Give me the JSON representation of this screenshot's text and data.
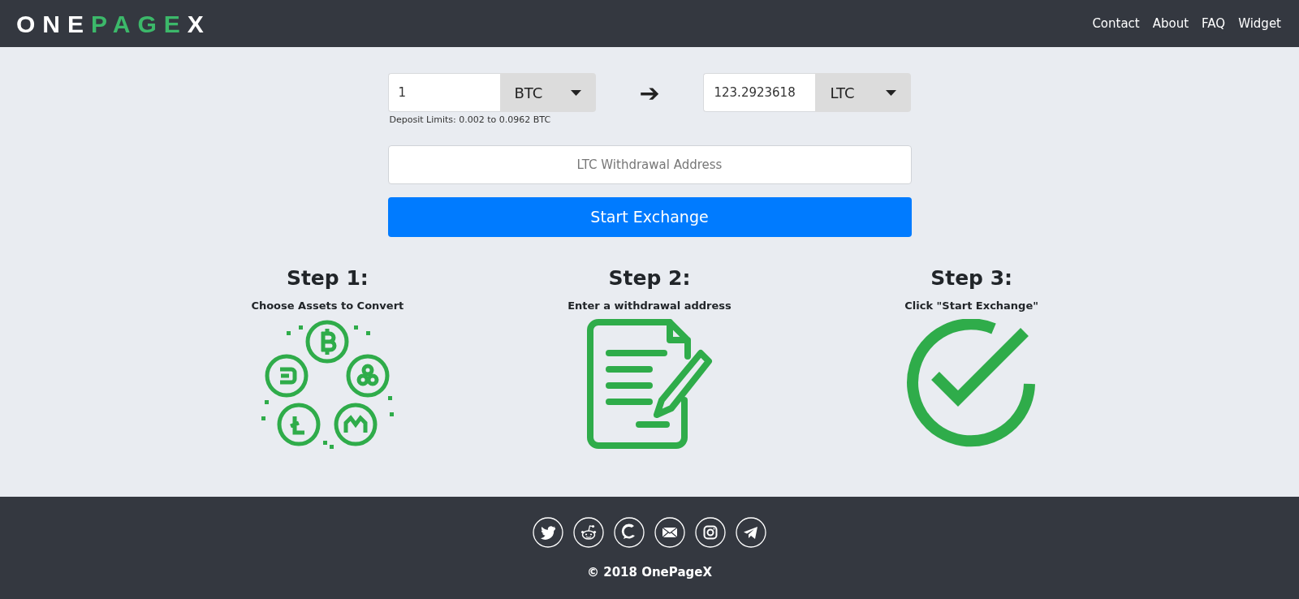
{
  "header": {
    "logo": [
      {
        "text": "ONE",
        "color": "#ffffff"
      },
      {
        "text": "PAGE",
        "color": "#3cb86a"
      },
      {
        "text": "X",
        "color": "#ffffff"
      }
    ],
    "nav": [
      "Contact",
      "About",
      "FAQ",
      "Widget"
    ]
  },
  "exchange": {
    "from": {
      "value": "1",
      "currency": "BTC"
    },
    "arrow": "➔",
    "to": {
      "value": "123.2923618",
      "currency": "LTC"
    },
    "deposit_limits": "Deposit Limits: 0.002 to 0.0962 BTC",
    "address": {
      "placeholder": "LTC Withdrawal Address"
    },
    "button": "Start Exchange"
  },
  "steps": [
    {
      "kind": "coins",
      "title": "Step 1:",
      "text": "Choose Assets to Convert"
    },
    {
      "kind": "document",
      "title": "Step 2:",
      "text": "Enter a withdrawal address"
    },
    {
      "kind": "check",
      "title": "Step 3:",
      "text": "Click \"Start Exchange\""
    }
  ],
  "footer": {
    "copyright": "© 2018 OnePageX"
  }
}
